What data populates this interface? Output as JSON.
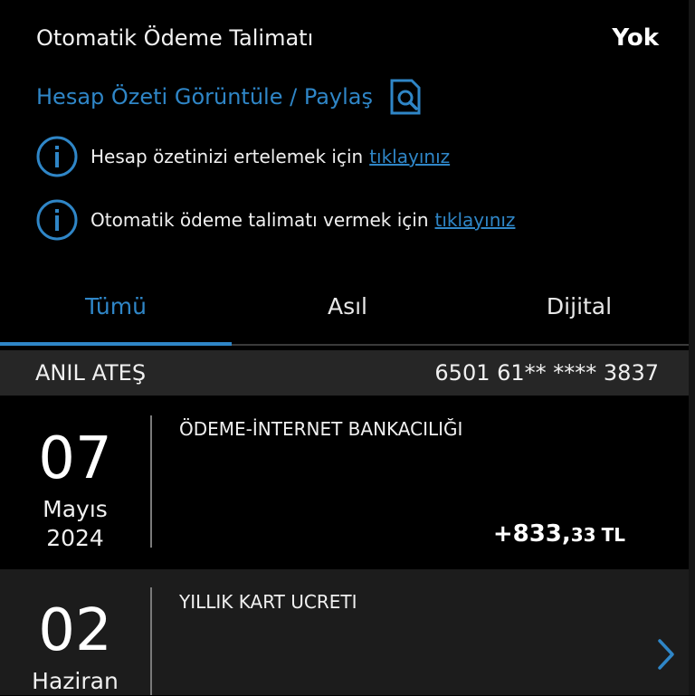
{
  "auto_payment": {
    "label": "Otomatik Ödeme Talimatı",
    "value": "Yok"
  },
  "statement": {
    "label": "Hesap Özeti Görüntüle / Paylaş",
    "icon": "document-search-icon"
  },
  "info_rows": [
    {
      "icon": "info-icon",
      "text": "Hesap özetinizi ertelemek için",
      "link": "tıklayınız"
    },
    {
      "icon": "info-icon",
      "text": "Otomatik ödeme talimatı vermek için",
      "link": "tıklayınız"
    }
  ],
  "tabs": [
    {
      "label": "Tümü",
      "active": true
    },
    {
      "label": "Asıl",
      "active": false
    },
    {
      "label": "Dijital",
      "active": false
    }
  ],
  "card": {
    "holder": "ANIL ATEŞ",
    "number": "6501 61** **** 3837"
  },
  "transactions": [
    {
      "day": "07",
      "month": "Mayıs",
      "year": "2024",
      "description": "ÖDEME-İNTERNET BANKACILIĞI",
      "amount_int": "+833,",
      "amount_dec": "33",
      "currency": "TL"
    },
    {
      "day": "02",
      "month": "Haziran",
      "description": "YILLIK KART UCRETI"
    }
  ],
  "colors": {
    "accent": "#2f86c7",
    "background": "#000000",
    "header_band": "#262626",
    "alt_row": "#1c1c1c"
  }
}
